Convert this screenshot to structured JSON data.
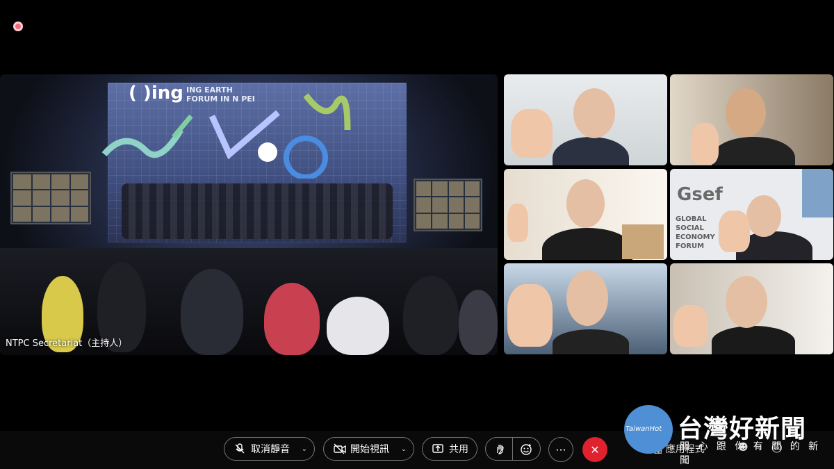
{
  "host_label": "NTPC Secretariat（主持人）",
  "stage_logo": "( )ing",
  "stage_forum_text_line1": "ING EARTH",
  "stage_forum_text_line2": "FORUM IN N    PEI",
  "gsef_logo": "Gsef",
  "gsef_text": [
    "GLOBAL",
    "SOCIAL",
    "ECONOMY",
    "FORUM"
  ],
  "toolbar": {
    "unmute_label": "取消靜音",
    "video_label": "開始視訊",
    "share_label": "共用",
    "more_label": "···",
    "end_label": "✕",
    "apps_label": "應用程式"
  },
  "watermark": {
    "title": "台灣好新聞",
    "sub": "TaiwanHot",
    "slogan": "關 心 跟 你 有 關 的 新 聞"
  },
  "colors": {
    "end_button": "#e0222e",
    "record_dot": "#f26a7a",
    "watermark_circle": "#4e8fd6"
  }
}
